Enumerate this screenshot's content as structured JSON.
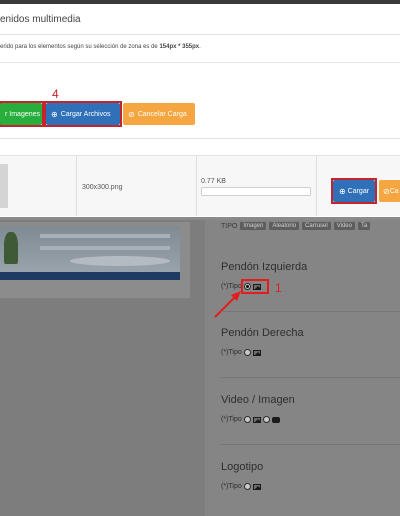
{
  "modal": {
    "title": "enidos multimedia",
    "hint_prefix": "erido para los elementos según su selección de zona es de ",
    "hint_size": "154px * 355px",
    "hint_suffix": ".",
    "step_number": "4",
    "buttons": {
      "add_images": "r Imagenes",
      "upload_files": "Cargar Archivos",
      "cancel_upload": "Cancelar Carga"
    },
    "file_row": {
      "filename": "300x300.png",
      "size": "0.77 KB",
      "progress": 0,
      "upload_button": "Cargar",
      "cancel_button": "Ca"
    }
  },
  "right_panel": {
    "tipo_label": "TIPO",
    "tipo_tags": [
      "Imagen",
      "Aleatorio",
      "Carrusel",
      "Video",
      "Ta"
    ],
    "sections": [
      {
        "title": "Pendón Izquierda",
        "tipo": "(*)Tipo"
      },
      {
        "title": "Pendón Derecha",
        "tipo": "(*)Tipo"
      },
      {
        "title": "Video / Imagen",
        "tipo": "(*)Tipo"
      },
      {
        "title": "Logotipo",
        "tipo": "(*)Tipo"
      }
    ],
    "step_number": "1"
  },
  "colors": {
    "primary_blue": "#2f70b8",
    "green": "#27ae3c",
    "orange": "#f5a640",
    "annotation_red": "#e21d1d"
  }
}
